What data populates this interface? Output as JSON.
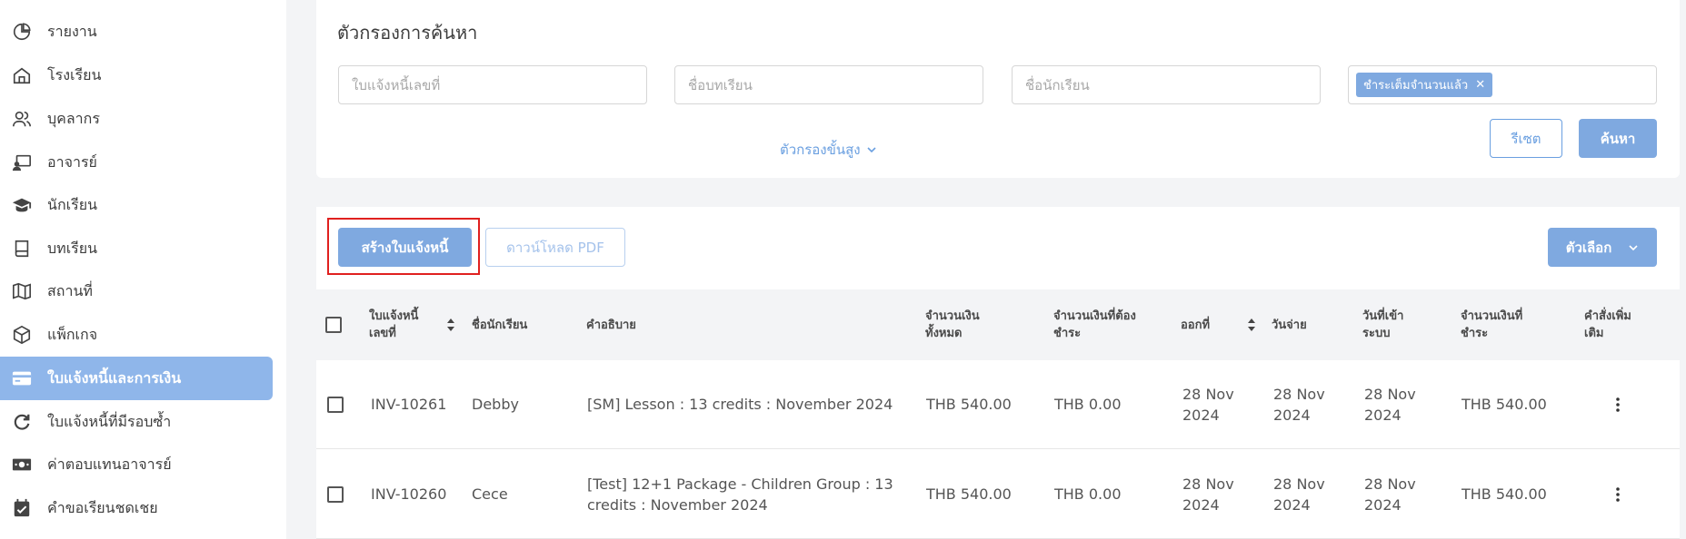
{
  "sidebar": {
    "items": [
      {
        "label": "รายงาน",
        "icon": "pie-chart-icon"
      },
      {
        "label": "โรงเรียน",
        "icon": "home-icon"
      },
      {
        "label": "บุคลากร",
        "icon": "users-icon"
      },
      {
        "label": "อาจารย์",
        "icon": "teacher-icon"
      },
      {
        "label": "นักเรียน",
        "icon": "graduation-cap-icon"
      },
      {
        "label": "บทเรียน",
        "icon": "book-icon"
      },
      {
        "label": "สถานที่",
        "icon": "map-icon"
      },
      {
        "label": "แพ็กเกจ",
        "icon": "package-icon"
      },
      {
        "label": "ใบแจ้งหนี้และการเงิน",
        "icon": "credit-card-icon",
        "active": true
      },
      {
        "label": "ใบแจ้งหนี้ที่มีรอบซ้ำ",
        "icon": "refresh-icon"
      },
      {
        "label": "ค่าตอบแทนอาจารย์",
        "icon": "money-icon"
      },
      {
        "label": "คำขอเรียนชดเชย",
        "icon": "calendar-check-icon"
      }
    ]
  },
  "filter": {
    "title": "ตัวกรองการค้นหา",
    "invoice_no_placeholder": "ใบแจ้งหนี้เลขที่",
    "lesson_placeholder": "ชื่อบทเรียน",
    "student_placeholder": "ชื่อนักเรียน",
    "status_tag": "ชำระเต็มจำนวนแล้ว",
    "advanced_label": "ตัวกรองขั้นสูง",
    "reset_label": "รีเซต",
    "search_label": "ค้นหา"
  },
  "toolbar": {
    "create_label": "สร้างใบแจ้งหนี้",
    "download_label": "ดาวน์โหลด PDF",
    "options_label": "ตัวเลือก"
  },
  "table": {
    "headers": {
      "invoice_no": [
        "ใบแจ้งหนี้",
        "เลขที่"
      ],
      "student": "ชื่อนักเรียน",
      "description": "คำอธิบาย",
      "total": [
        "จำนวนเงิน",
        "ทั้งหมด"
      ],
      "due": [
        "จำนวนเงินที่ต้อง",
        "ชำระ"
      ],
      "issued": "ออกที่",
      "due_date": "วันจ่าย",
      "entered": [
        "วันที่เข้า",
        "ระบบ"
      ],
      "paid": [
        "จำนวนเงินที่",
        "ชำระ"
      ],
      "actions": [
        "คำสั่งเพิ่ม",
        "เติม"
      ]
    },
    "rows": [
      {
        "invoice_no": "INV-10261",
        "student": "Debby",
        "description": [
          "[SM] Lesson : 13 credits : November 2024"
        ],
        "total": "THB 540.00",
        "due": "THB 0.00",
        "issued": [
          "28 Nov",
          "2024"
        ],
        "due_date": [
          "28 Nov",
          "2024"
        ],
        "entered": [
          "28 Nov",
          "2024"
        ],
        "paid": "THB 540.00"
      },
      {
        "invoice_no": "INV-10260",
        "student": "Cece",
        "description": [
          "[Test] 12+1 Package - Children Group : 13",
          "credits : November 2024"
        ],
        "total": "THB 540.00",
        "due": "THB 0.00",
        "issued": [
          "28 Nov",
          "2024"
        ],
        "due_date": [
          "28 Nov",
          "2024"
        ],
        "entered": [
          "28 Nov",
          "2024"
        ],
        "paid": "THB 540.00"
      }
    ]
  },
  "colors": {
    "accent": "#7fa9e0",
    "active_nav": "#8fb6ea",
    "highlight": "#e0201f"
  }
}
